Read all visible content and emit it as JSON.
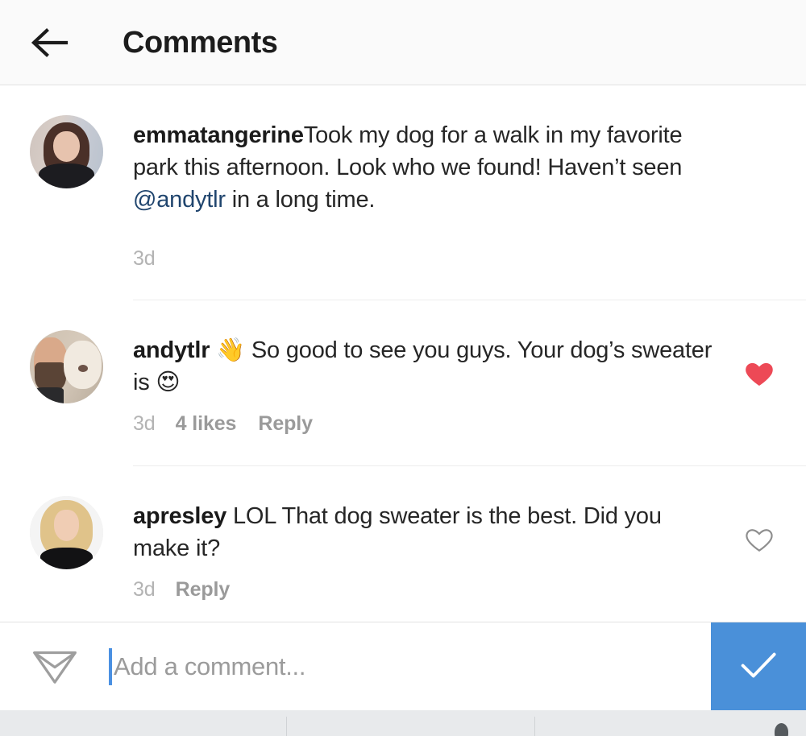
{
  "header": {
    "title": "Comments",
    "back_icon": "arrow-left-icon"
  },
  "comments": [
    {
      "username": "emmatangerine",
      "text_before_mention": "Took my dog for a walk in my favorite park this afternoon. Look who we found! Haven’t seen ",
      "mention": "@andytlr",
      "text_after_mention": " in a long time.",
      "time": "3d",
      "likes": "",
      "reply": "",
      "avatar": "emmatangerine-avatar",
      "liked": null,
      "like_icon": ""
    },
    {
      "username": "andytlr",
      "text_before_mention": " 👋 So good to see you guys. Your dog’s sweater is 😍",
      "mention": "",
      "text_after_mention": "",
      "time": "3d",
      "likes": "4 likes",
      "reply": "Reply",
      "avatar": "andytlr-avatar",
      "liked": true,
      "like_icon": "heart-filled-icon"
    },
    {
      "username": "apresley",
      "text_before_mention": " LOL That dog sweater is the best. Did you make it?",
      "mention": "",
      "text_after_mention": "",
      "time": "3d",
      "likes": "",
      "reply": "Reply",
      "avatar": "apresley-avatar",
      "liked": false,
      "like_icon": "heart-outline-icon"
    }
  ],
  "input_bar": {
    "send_icon": "paper-plane-icon",
    "placeholder": "Add a comment...",
    "value": "",
    "submit_icon": "check-icon"
  },
  "colors": {
    "accent_blue": "#4a90d9",
    "caret_blue": "#4a90e2",
    "heart_red": "#ed4956",
    "mention_blue": "#20456e",
    "meta_gray": "#9a9a9a",
    "time_gray": "#b3b3b3",
    "text_dark": "#262626",
    "header_bg": "#fafafa",
    "navbar_bg": "#e8eaec"
  }
}
